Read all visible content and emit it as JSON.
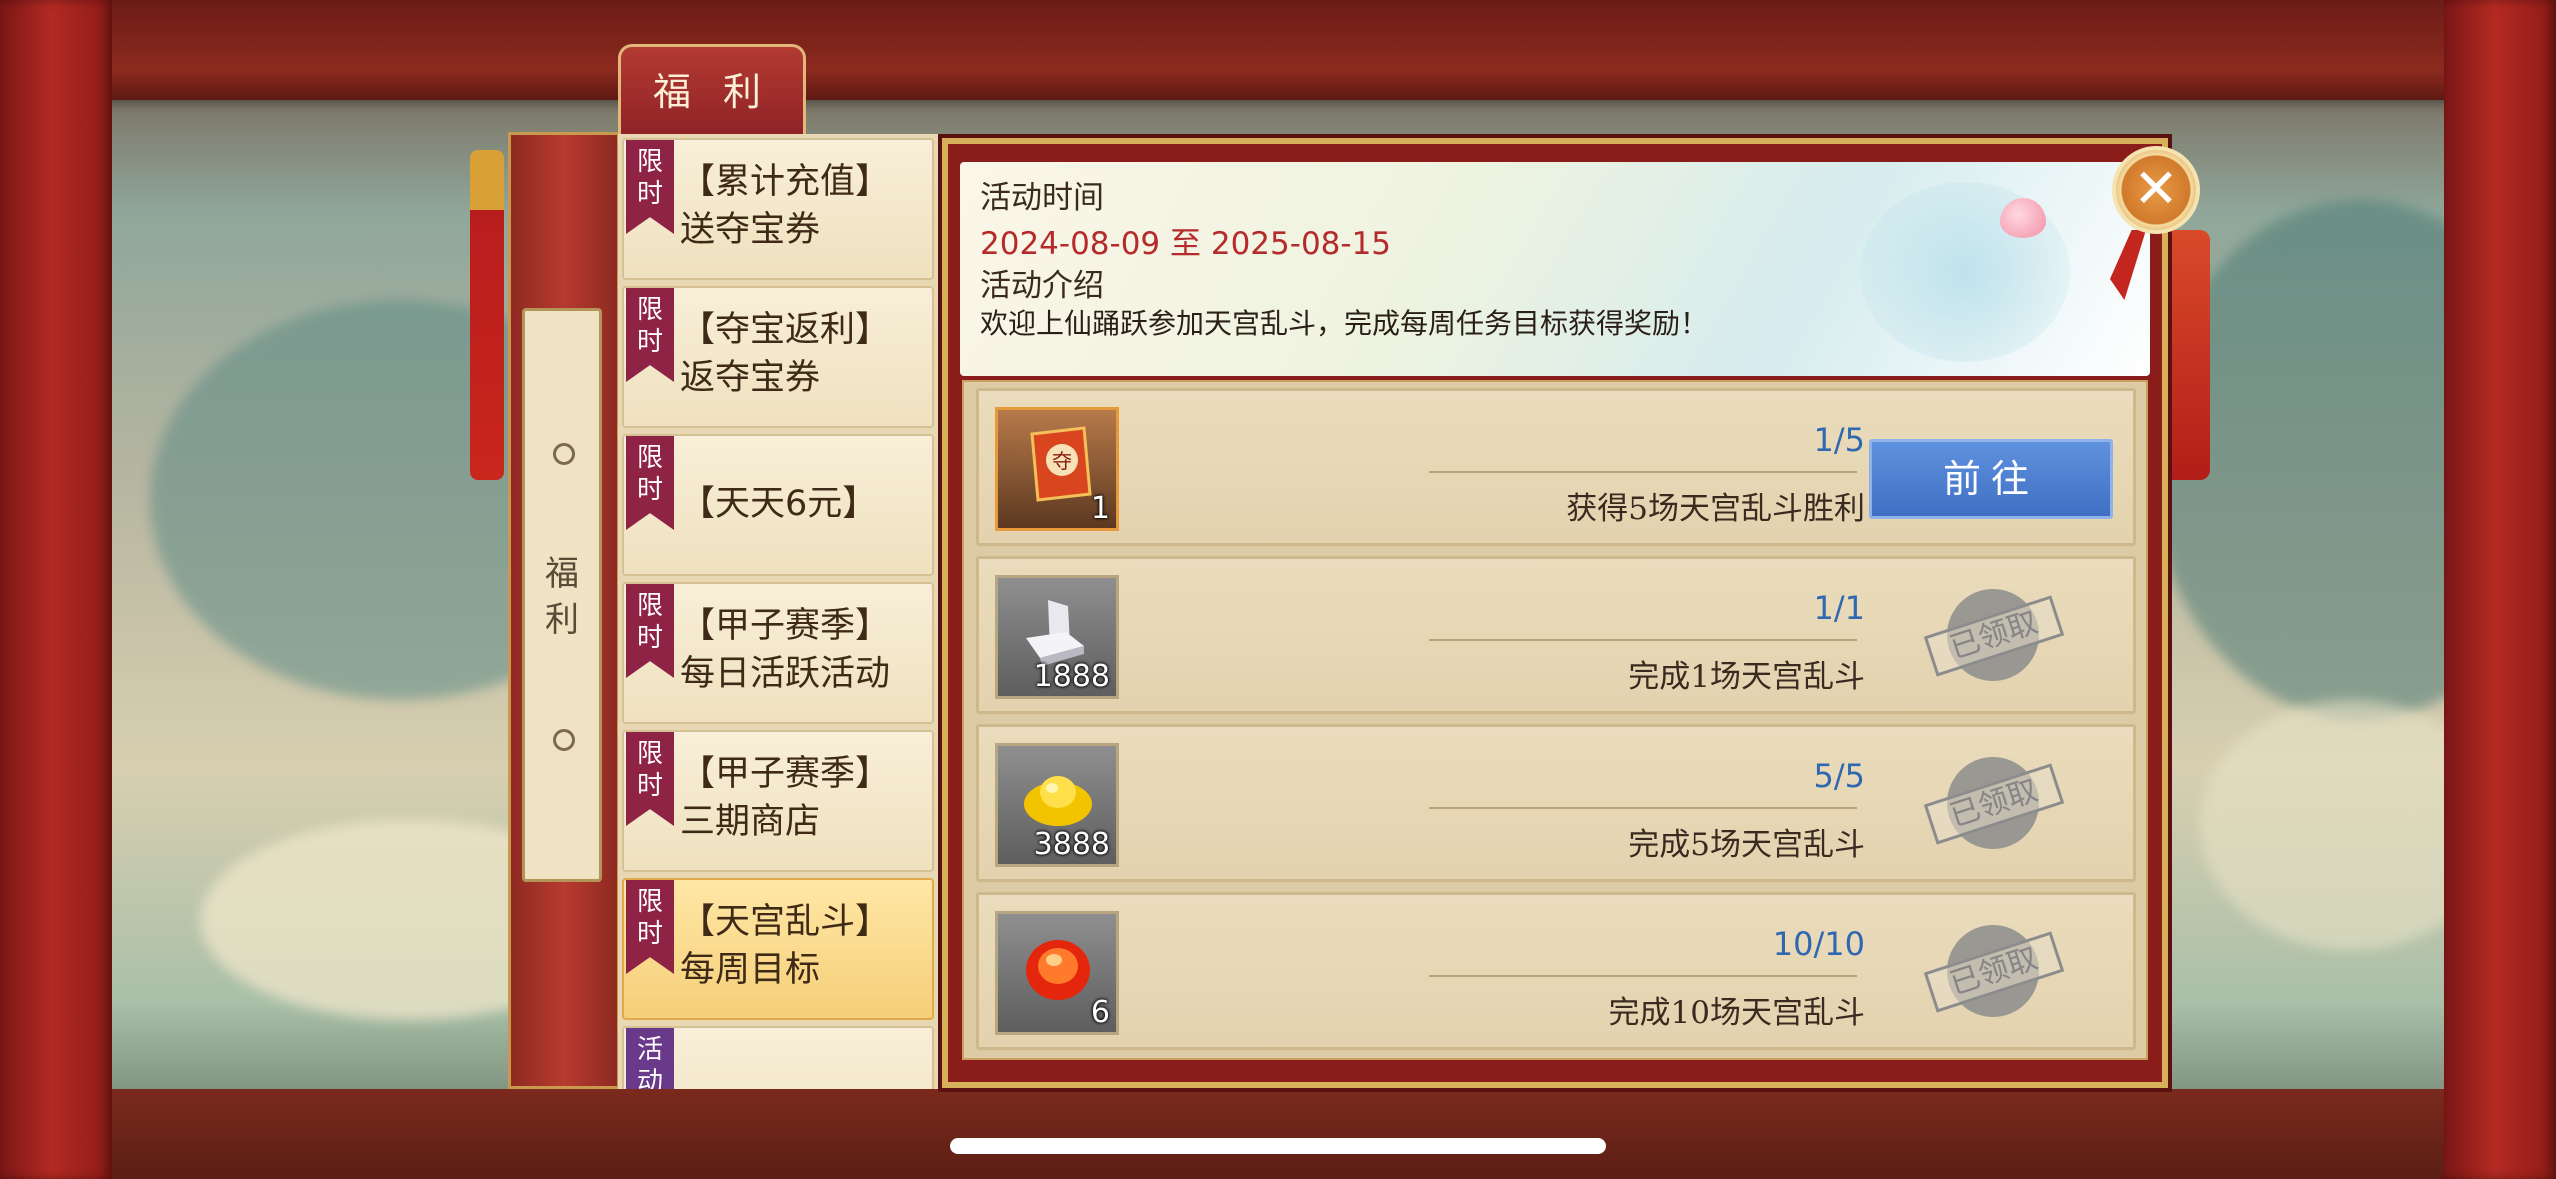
{
  "top_tab": {
    "label": "福 利"
  },
  "side_scroll": {
    "label": "福\n利"
  },
  "nav_items": [
    {
      "badge": "限\n时",
      "badge_type": "limited",
      "title": "【累计充值】\n送夺宝券",
      "active": false
    },
    {
      "badge": "限\n时",
      "badge_type": "limited",
      "title": "【夺宝返利】\n返夺宝券",
      "active": false
    },
    {
      "badge": "限\n时",
      "badge_type": "limited",
      "title": "【天天6元】",
      "active": false
    },
    {
      "badge": "限\n时",
      "badge_type": "limited",
      "title": "【甲子赛季】\n每日活跃活动",
      "active": false
    },
    {
      "badge": "限\n时",
      "badge_type": "limited",
      "title": "【甲子赛季】\n三期商店",
      "active": false
    },
    {
      "badge": "限\n时",
      "badge_type": "limited",
      "title": "【天宫乱斗】\n每周目标",
      "active": true
    },
    {
      "badge": "活\n动",
      "badge_type": "event",
      "title": "",
      "active": false
    }
  ],
  "activity": {
    "time_label": "活动时间",
    "date_range": "2024-08-09 至 2025-08-15",
    "intro_label": "活动介绍",
    "intro_text": "欢迎上仙踊跃参加天宫乱斗，完成每周任务目标获得奖励！"
  },
  "tasks": [
    {
      "reward_icon": "seize-ticket-icon",
      "reward_qty": "1",
      "progress": "1/5",
      "description": "获得5场天宫乱斗胜利",
      "action": "go",
      "button_label": "前往"
    },
    {
      "reward_icon": "silver-ingot-icon",
      "reward_qty": "1888",
      "progress": "1/1",
      "description": "完成1场天宫乱斗",
      "action": "claimed",
      "stamp_label": "已领取"
    },
    {
      "reward_icon": "gold-ingot-icon",
      "reward_qty": "3888",
      "progress": "5/5",
      "description": "完成5场天宫乱斗",
      "action": "claimed",
      "stamp_label": "已领取"
    },
    {
      "reward_icon": "red-gem-icon",
      "reward_qty": "6",
      "progress": "10/10",
      "description": "完成10场天宫乱斗",
      "action": "claimed",
      "stamp_label": "已领取"
    }
  ],
  "close": {
    "glyph": "✕"
  },
  "colors": {
    "accent_red": "#b52a2a",
    "progress_blue": "#2f67b0",
    "button_blue": "#4a7fd1",
    "panel_gold": "#d8b05a"
  }
}
